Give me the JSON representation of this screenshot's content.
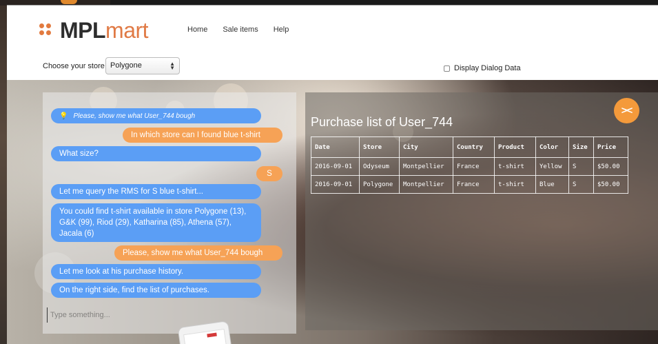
{
  "app": {
    "brand_bold": "MPL",
    "brand_light": "mart",
    "brand_color": "#e07a45",
    "logo_icon": "four-dots-logo-icon"
  },
  "nav": {
    "items": [
      {
        "label": "Home"
      },
      {
        "label": "Sale items"
      },
      {
        "label": "Help"
      }
    ]
  },
  "store": {
    "label": "Choose your store",
    "selected": "Polygone"
  },
  "dialog_toggle": {
    "label": "Display Dialog Data",
    "checked": false
  },
  "chat": {
    "bot_color": "#5b9ef5",
    "user_color": "#f6a256",
    "messages": [
      {
        "from": "bot",
        "text": "Please, show me what User_744 bough",
        "icon": "lightbulb-icon"
      },
      {
        "from": "user",
        "text": "In which store can I found blue t-shirt"
      },
      {
        "from": "bot",
        "text": "What size?"
      },
      {
        "from": "user",
        "text": "S"
      },
      {
        "from": "bot",
        "text": "Let me query the RMS for S blue t-shirt..."
      },
      {
        "from": "bot",
        "text": "You could find t-shirt available in store Polygone (13), G&K (99), Riod (29), Katharina (85), Athena (57), Jacala (6)"
      },
      {
        "from": "user",
        "text": "Please, show me what User_744 bough"
      },
      {
        "from": "bot",
        "text": "Let me look at his purchase history."
      },
      {
        "from": "bot",
        "text": "On the right side, find the list of purchases."
      }
    ],
    "input_placeholder": "Type something..."
  },
  "purchase": {
    "title": "Purchase list of User_744",
    "collapse_icon": "collapse-arrows-icon",
    "collapse_label": "><",
    "columns": [
      "Date",
      "Store",
      "City",
      "Country",
      "Product",
      "Color",
      "Size",
      "Price"
    ],
    "rows": [
      [
        "2016-09-01",
        "Odyseum",
        "Montpellier",
        "France",
        "t-shirt",
        "Yellow",
        "S",
        "$50.00"
      ],
      [
        "2016-09-01",
        "Polygone",
        "Montpellier",
        "France",
        "t-shirt",
        "Blue",
        "S",
        "$50.00"
      ]
    ]
  }
}
